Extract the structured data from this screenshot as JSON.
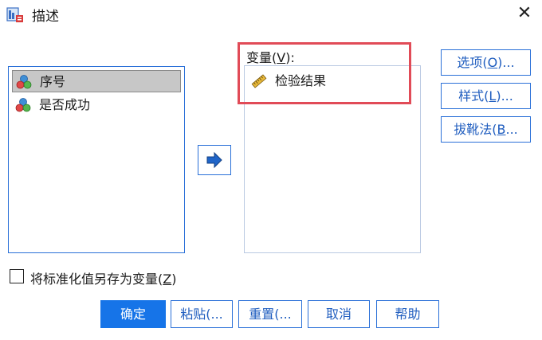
{
  "window": {
    "title": "描述",
    "close_glyph": "✕"
  },
  "source_list": {
    "items": [
      {
        "label": "序号",
        "icon": "nominal-variable-icon",
        "selected": true
      },
      {
        "label": "是否成功",
        "icon": "nominal-variable-icon",
        "selected": false
      }
    ]
  },
  "variables_panel": {
    "label_prefix": "变量(",
    "label_key": "V",
    "label_suffix": "):",
    "items": [
      {
        "label": "检验结果",
        "icon": "scale-variable-icon"
      }
    ]
  },
  "side_buttons": {
    "options": {
      "prefix": "选项(",
      "key": "O",
      "suffix": ")..."
    },
    "style": {
      "prefix": "样式(",
      "key": "L",
      "suffix": ")..."
    },
    "bootstrap": {
      "prefix": "拔靴法(",
      "key": "B",
      "suffix": "..."
    }
  },
  "checkbox": {
    "prefix": "将标准化值另存为变量(",
    "key": "Z",
    "suffix": ")",
    "checked": false
  },
  "bottom_buttons": {
    "ok": "确定",
    "paste": "粘贴(...",
    "reset": "重置(...",
    "cancel": "取消",
    "help": "帮助"
  },
  "colors": {
    "accent": "#1674e8",
    "border": "#2a70d8",
    "highlight": "#e14b57",
    "selection": "#c7c7c7"
  }
}
